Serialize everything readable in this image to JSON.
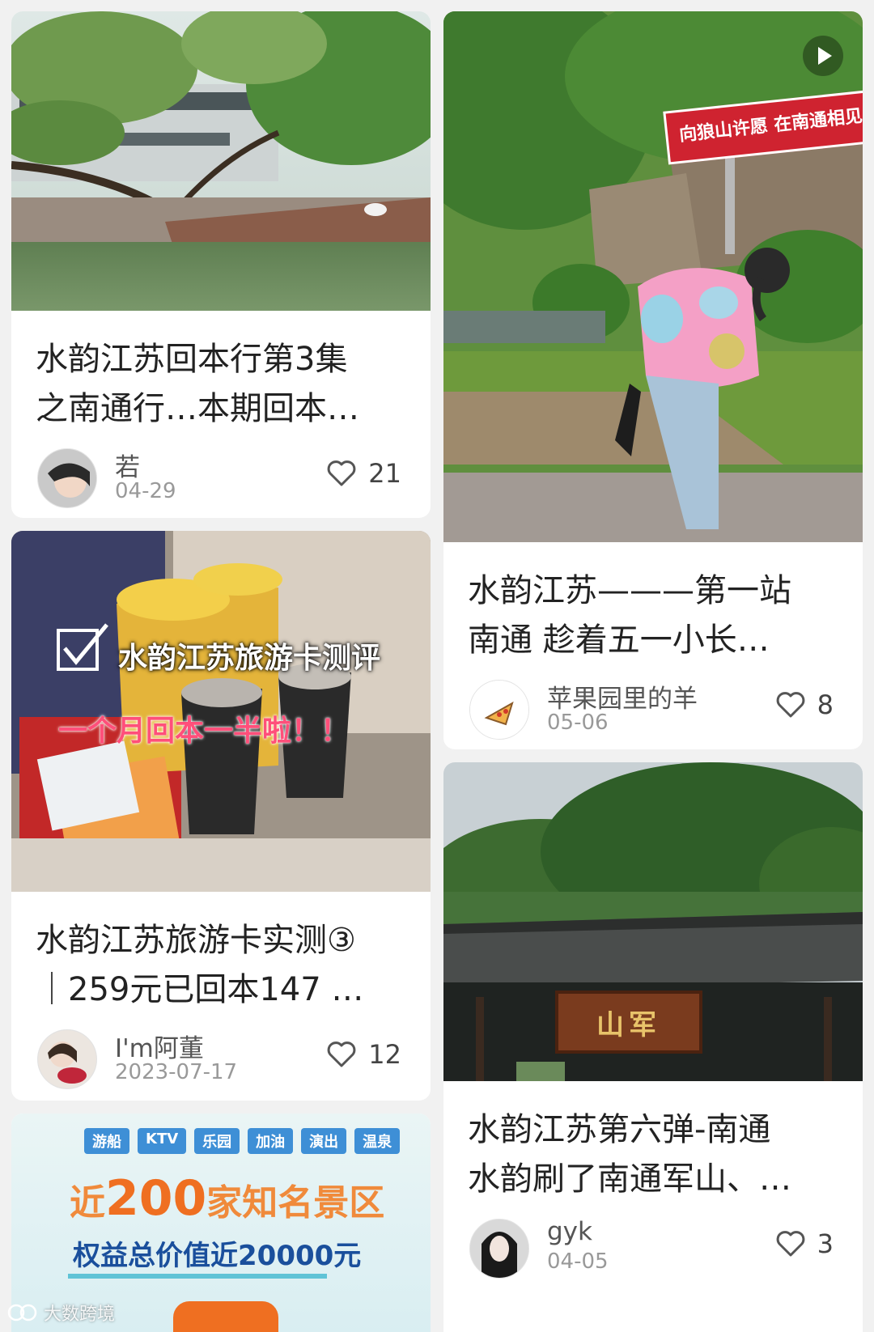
{
  "colors": {
    "background": "#f1f1f1",
    "card": "#ffffff",
    "sign_red": "#cf2330",
    "ad_orange": "#ef6f21",
    "ad_blue": "#1a4f9c"
  },
  "cards": [
    {
      "title_line1": "水韵江苏回本行第3集",
      "title_line2": "之南通行…本期回本…",
      "author": "若",
      "date": "04-29",
      "likes": "21",
      "cover_desc": "garden pond with goose"
    },
    {
      "title_line1": "水韵江苏旅游卡实测③",
      "title_line2": "｜259元已回本147 …",
      "author": "I'm阿董",
      "date": "2023-07-17",
      "likes": "12",
      "cover_overlay_line1": "水韵江苏旅游卡测评",
      "cover_overlay_line2": "一个月回本一半啦！！"
    },
    {
      "ad_tags": [
        "游船",
        "KTV",
        "乐园",
        "加油",
        "演出",
        "温泉"
      ],
      "ad_prefix": "近",
      "ad_number": "200",
      "ad_suffix": "家知名景区",
      "ad_sub": "权益总价值近20000元"
    },
    {
      "title_line1": "水韵江苏———第一站",
      "title_line2": "南通 趁着五一小长…",
      "author": "苹果园里的羊",
      "date": "05-06",
      "likes": "8",
      "sign_text": "向狼山许愿 在南通相见",
      "has_video": true
    },
    {
      "title_line1": "水韵江苏第六弹-南通",
      "title_line2": "水韵刷了南通军山、…",
      "author": "gyk",
      "date": "04-05",
      "likes": "3",
      "plaque_text": "山军"
    }
  ],
  "watermark": "大数跨境",
  "icons": [
    "heart-icon",
    "play-icon",
    "avatar",
    "watermark-logo-icon"
  ]
}
